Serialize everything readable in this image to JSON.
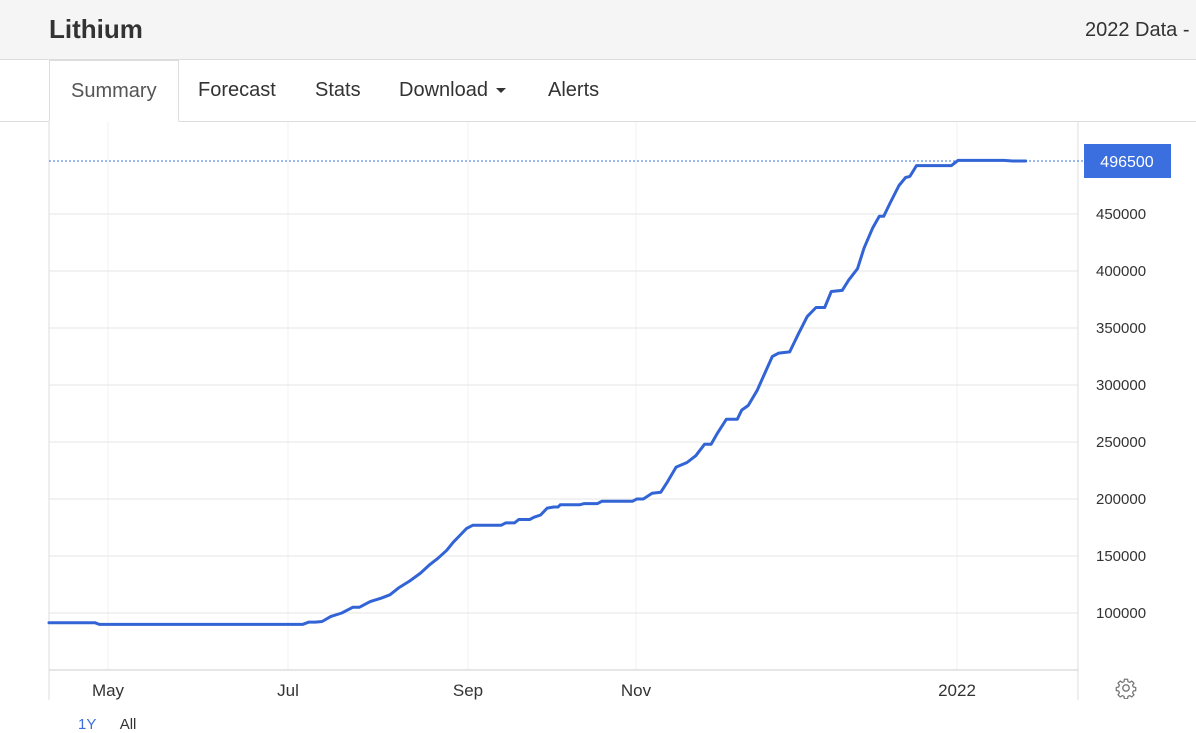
{
  "header": {
    "title": "Lithium",
    "data_title": "2022 Data -"
  },
  "tabs": [
    {
      "label": "Summary",
      "active": true
    },
    {
      "label": "Forecast"
    },
    {
      "label": "Stats"
    },
    {
      "label": "Download",
      "has_dropdown": true
    },
    {
      "label": "Alerts"
    }
  ],
  "colors": {
    "line": "#3264d6",
    "last_value_badge": "#3b6fe0",
    "grid": "#e6e6e6"
  },
  "range_selector": [
    "1Y",
    "All"
  ],
  "settings_icon": "gear-icon",
  "chart_data": {
    "type": "line",
    "title": "",
    "xlabel": "",
    "ylabel": "",
    "x_tick_labels": [
      "May",
      "Jul",
      "Sep",
      "Nov",
      "2022"
    ],
    "y_tick_labels": [
      "100000",
      "150000",
      "200000",
      "250000",
      "300000",
      "350000",
      "400000",
      "450000"
    ],
    "ylim": [
      50000,
      520000
    ],
    "grid": true,
    "last_value": 496500,
    "last_value_label": "496500",
    "series": [
      {
        "points": [
          [
            "2021-04-13",
            91500
          ],
          [
            "2021-05-04",
            91500
          ],
          [
            "2021-05-06",
            90000
          ],
          [
            "2021-06-15",
            90000
          ],
          [
            "2021-07-20",
            90000
          ],
          [
            "2021-08-07",
            90000
          ],
          [
            "2021-08-10",
            92000
          ],
          [
            "2021-08-13",
            92000
          ],
          [
            "2021-08-16",
            92500
          ],
          [
            "2021-08-20",
            97000
          ],
          [
            "2021-08-25",
            100000
          ],
          [
            "2021-08-30",
            105000
          ],
          [
            "2021-09-02",
            105000
          ],
          [
            "2021-09-07",
            110000
          ],
          [
            "2021-09-12",
            113000
          ],
          [
            "2021-09-16",
            116000
          ],
          [
            "2021-09-20",
            122000
          ],
          [
            "2021-09-25",
            128000
          ],
          [
            "2021-09-30",
            135000
          ],
          [
            "2021-10-04",
            142000
          ],
          [
            "2021-10-08",
            148000
          ],
          [
            "2021-10-12",
            155000
          ],
          [
            "2021-10-15",
            162000
          ],
          [
            "2021-10-18",
            168000
          ],
          [
            "2021-10-21",
            174000
          ],
          [
            "2021-10-24",
            177000
          ],
          [
            "2021-11-06",
            177000
          ],
          [
            "2021-11-08",
            179000
          ],
          [
            "2021-11-12",
            179000
          ],
          [
            "2021-11-14",
            182000
          ],
          [
            "2021-11-19",
            182000
          ],
          [
            "2021-11-21",
            184000
          ],
          [
            "2021-11-24",
            186000
          ],
          [
            "2021-11-27",
            192000
          ],
          [
            "2021-11-30",
            193000
          ],
          [
            "2021-12-02",
            193000
          ],
          [
            "2021-12-03",
            195000
          ],
          [
            "2021-12-12",
            195000
          ],
          [
            "2021-12-14",
            196000
          ],
          [
            "2021-12-20",
            196000
          ],
          [
            "2021-12-22",
            198000
          ],
          [
            "2022-01-05",
            198000
          ],
          [
            "2022-01-07",
            200000
          ],
          [
            "2022-01-10",
            200000
          ],
          [
            "2022-01-14",
            205000
          ],
          [
            "2022-01-18",
            206000
          ],
          [
            "2022-01-21",
            215000
          ],
          [
            "2022-01-25",
            228000
          ],
          [
            "2022-01-30",
            232000
          ],
          [
            "2022-02-03",
            238000
          ],
          [
            "2022-02-07",
            248000
          ],
          [
            "2022-02-10",
            248000
          ],
          [
            "2022-02-13",
            258000
          ],
          [
            "2022-02-17",
            270000
          ],
          [
            "2022-02-22",
            270000
          ],
          [
            "2022-02-24",
            278000
          ],
          [
            "2022-02-27",
            282000
          ],
          [
            "2022-03-03",
            295000
          ],
          [
            "2022-03-07",
            312000
          ],
          [
            "2022-03-10",
            325000
          ],
          [
            "2022-03-13",
            328000
          ],
          [
            "2022-03-18",
            329000
          ],
          [
            "2022-03-22",
            345000
          ],
          [
            "2022-03-26",
            360000
          ],
          [
            "2022-03-30",
            368000
          ],
          [
            "2022-04-03",
            368000
          ],
          [
            "2022-04-06",
            382000
          ],
          [
            "2022-04-11",
            383000
          ],
          [
            "2022-04-14",
            392000
          ],
          [
            "2022-04-18",
            402000
          ],
          [
            "2022-04-21",
            420000
          ],
          [
            "2022-04-25",
            438000
          ],
          [
            "2022-04-28",
            448000
          ],
          [
            "2022-04-30",
            448000
          ],
          [
            "2022-05-03",
            460000
          ],
          [
            "2022-05-07",
            475000
          ],
          [
            "2022-05-10",
            482000
          ],
          [
            "2022-05-12",
            483000
          ],
          [
            "2022-05-15",
            492500
          ],
          [
            "2022-05-31",
            492500
          ],
          [
            "2022-06-03",
            497000
          ],
          [
            "2022-06-24",
            497000
          ],
          [
            "2022-06-28",
            496500
          ],
          [
            "2022-07-04",
            496500
          ]
        ]
      }
    ]
  }
}
